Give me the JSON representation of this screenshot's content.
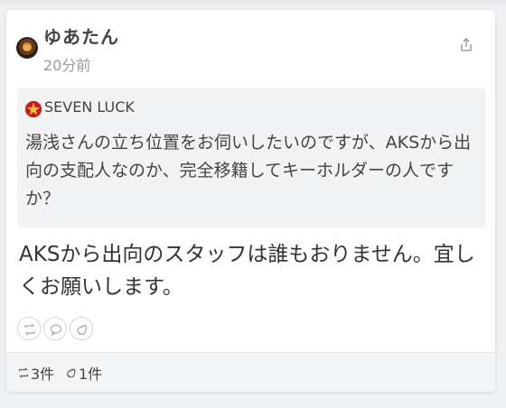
{
  "post": {
    "author": "ゆあたん",
    "time": "20分前",
    "quote": {
      "author": "SEVEN LUCK",
      "body": "湯浅さんの立ち位置をお伺いしたいのですが、AKSから出向の支配人なのか、完全移籍してキーホルダーの人ですか？"
    },
    "body": "AKSから出向のスタッフは誰もおりません。宜しくお願いします。",
    "stats": {
      "repost_count": "3件",
      "clap_count": "1件"
    }
  },
  "icons": {
    "share": "share-icon",
    "repost": "repost-icon",
    "reply": "reply-icon",
    "clap": "clap-icon"
  }
}
